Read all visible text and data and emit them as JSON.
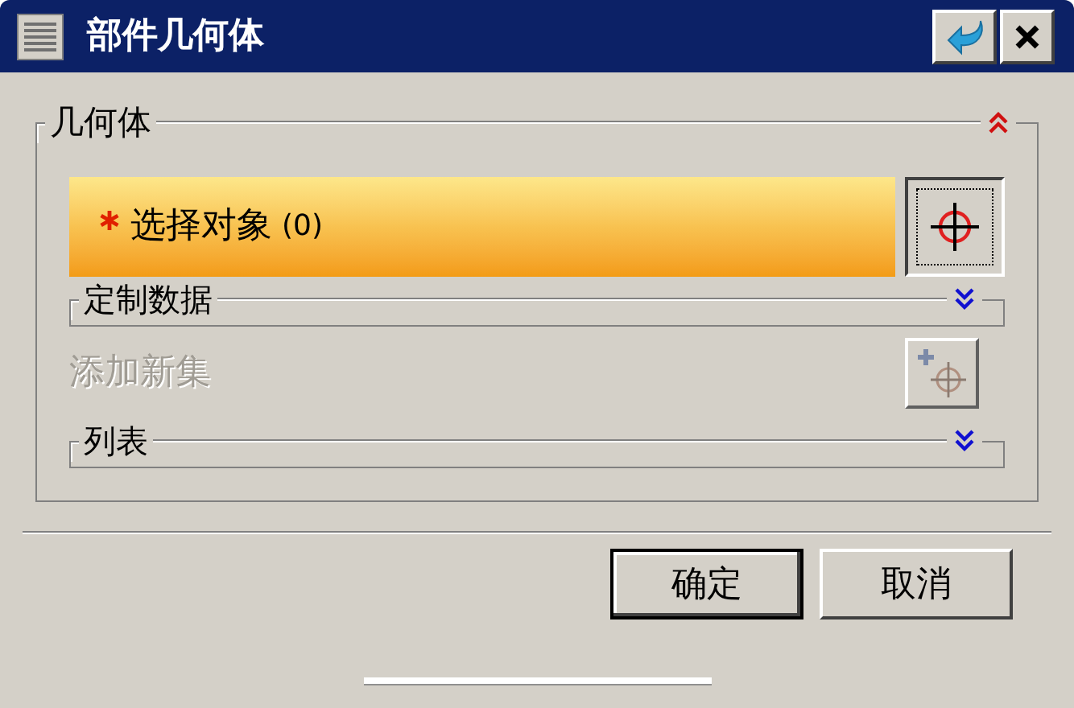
{
  "window": {
    "title": "部件几何体"
  },
  "group": {
    "title": "几何体",
    "expanded": true,
    "rows": [
      {
        "kind": "selection",
        "label": "选择对象",
        "count": "(0)",
        "required": true
      },
      {
        "kind": "subgroup",
        "title": "定制数据",
        "expanded": false
      },
      {
        "kind": "action",
        "label": "添加新集",
        "disabled": true
      },
      {
        "kind": "subgroup",
        "title": "列表",
        "expanded": false
      }
    ]
  },
  "buttons": [
    {
      "label": "确定",
      "default": true
    },
    {
      "label": "取消",
      "default": false
    }
  ]
}
